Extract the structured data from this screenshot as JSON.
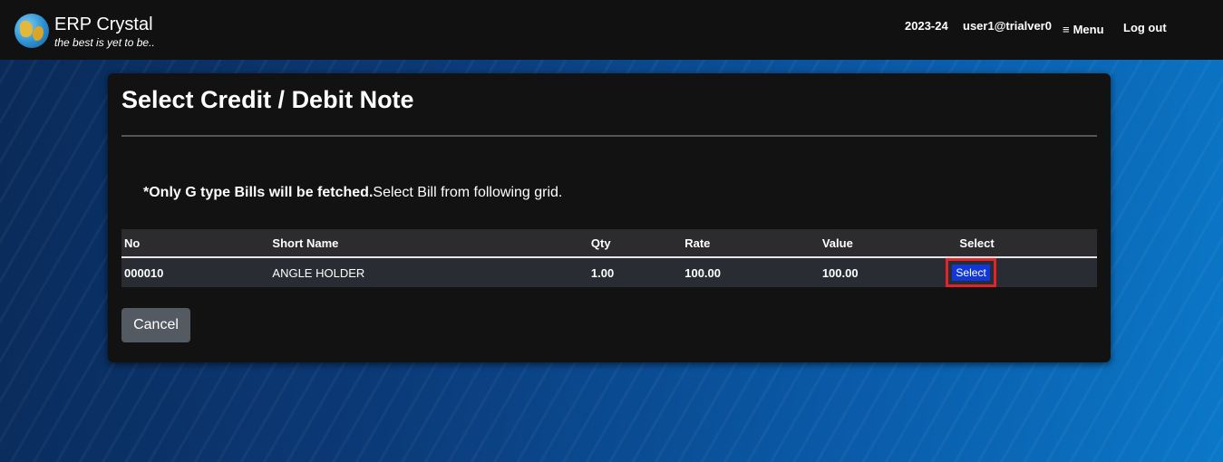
{
  "header": {
    "brand_title": "ERP Crystal",
    "brand_tagline": "the best is yet to be..",
    "year": "2023-24",
    "user": "user1@trialver0",
    "menu_label": "Menu",
    "logout_label": "Log out"
  },
  "panel": {
    "title": "Select Credit / Debit Note",
    "notice_bold": "*Only G type Bills will be fetched.",
    "notice_rest": "Select Bill from following grid."
  },
  "grid": {
    "headers": {
      "no": "No",
      "short_name": "Short Name",
      "qty": "Qty",
      "rate": "Rate",
      "value": "Value",
      "select": "Select"
    },
    "rows": [
      {
        "no": "000010",
        "short_name": "ANGLE HOLDER",
        "qty": "1.00",
        "rate": "100.00",
        "value": "100.00",
        "select_label": "Select"
      }
    ]
  },
  "actions": {
    "cancel_label": "Cancel"
  },
  "colors": {
    "select_button": "#1237d8",
    "highlight_border": "#e0242a"
  }
}
